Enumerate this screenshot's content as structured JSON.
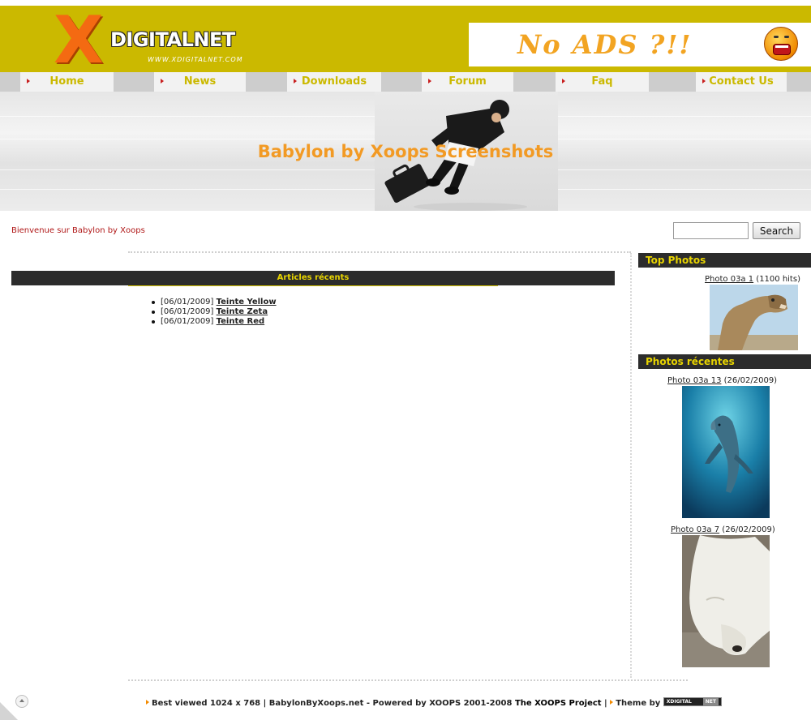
{
  "header": {
    "logo_mark": "X",
    "logo_name": "DIGITALNET",
    "logo_url": "WWW.XDIGITALNET.COM",
    "ad_text": "No ADS ?!!",
    "brand_color": "#cbb900"
  },
  "nav": {
    "items": [
      {
        "label": "Home"
      },
      {
        "label": "News"
      },
      {
        "label": "Downloads"
      },
      {
        "label": "Forum"
      },
      {
        "label": "Faq"
      },
      {
        "label": "Contact Us"
      }
    ]
  },
  "banner": {
    "title": "Babylon by Xoops Screenshots",
    "title_color": "#f29a24"
  },
  "welcome": {
    "text": "Bienvenue sur Babylon by Xoops"
  },
  "search": {
    "value": "",
    "button_label": "Search"
  },
  "center_block": {
    "title": "Articles récents",
    "articles": [
      {
        "date": "[06/01/2009]",
        "title": "Teinte Yellow"
      },
      {
        "date": "[06/01/2009]",
        "title": "Teinte Zeta"
      },
      {
        "date": "[06/01/2009]",
        "title": "Teinte Red"
      }
    ]
  },
  "top_photos": {
    "title": "Top Photos",
    "items": [
      {
        "name": "Photo 03a 1",
        "meta": " (1100 hits)"
      }
    ]
  },
  "recent_photos": {
    "title": "Photos récentes",
    "items": [
      {
        "name": "Photo 03a 13",
        "meta": " (26/02/2009)"
      },
      {
        "name": "Photo 03a 7",
        "meta": " (26/02/2009)"
      }
    ]
  },
  "footer": {
    "best_viewed": "Best viewed 1024 x 768",
    "site": "BabylonByXoops.net",
    "powered": "- Powered by XOOPS 2001-2008",
    "project": "The XOOPS Project",
    "theme_by": "Theme by",
    "theme_badge_a": "XDIGITAL",
    "theme_badge_b": "NET",
    "separator": "|"
  }
}
